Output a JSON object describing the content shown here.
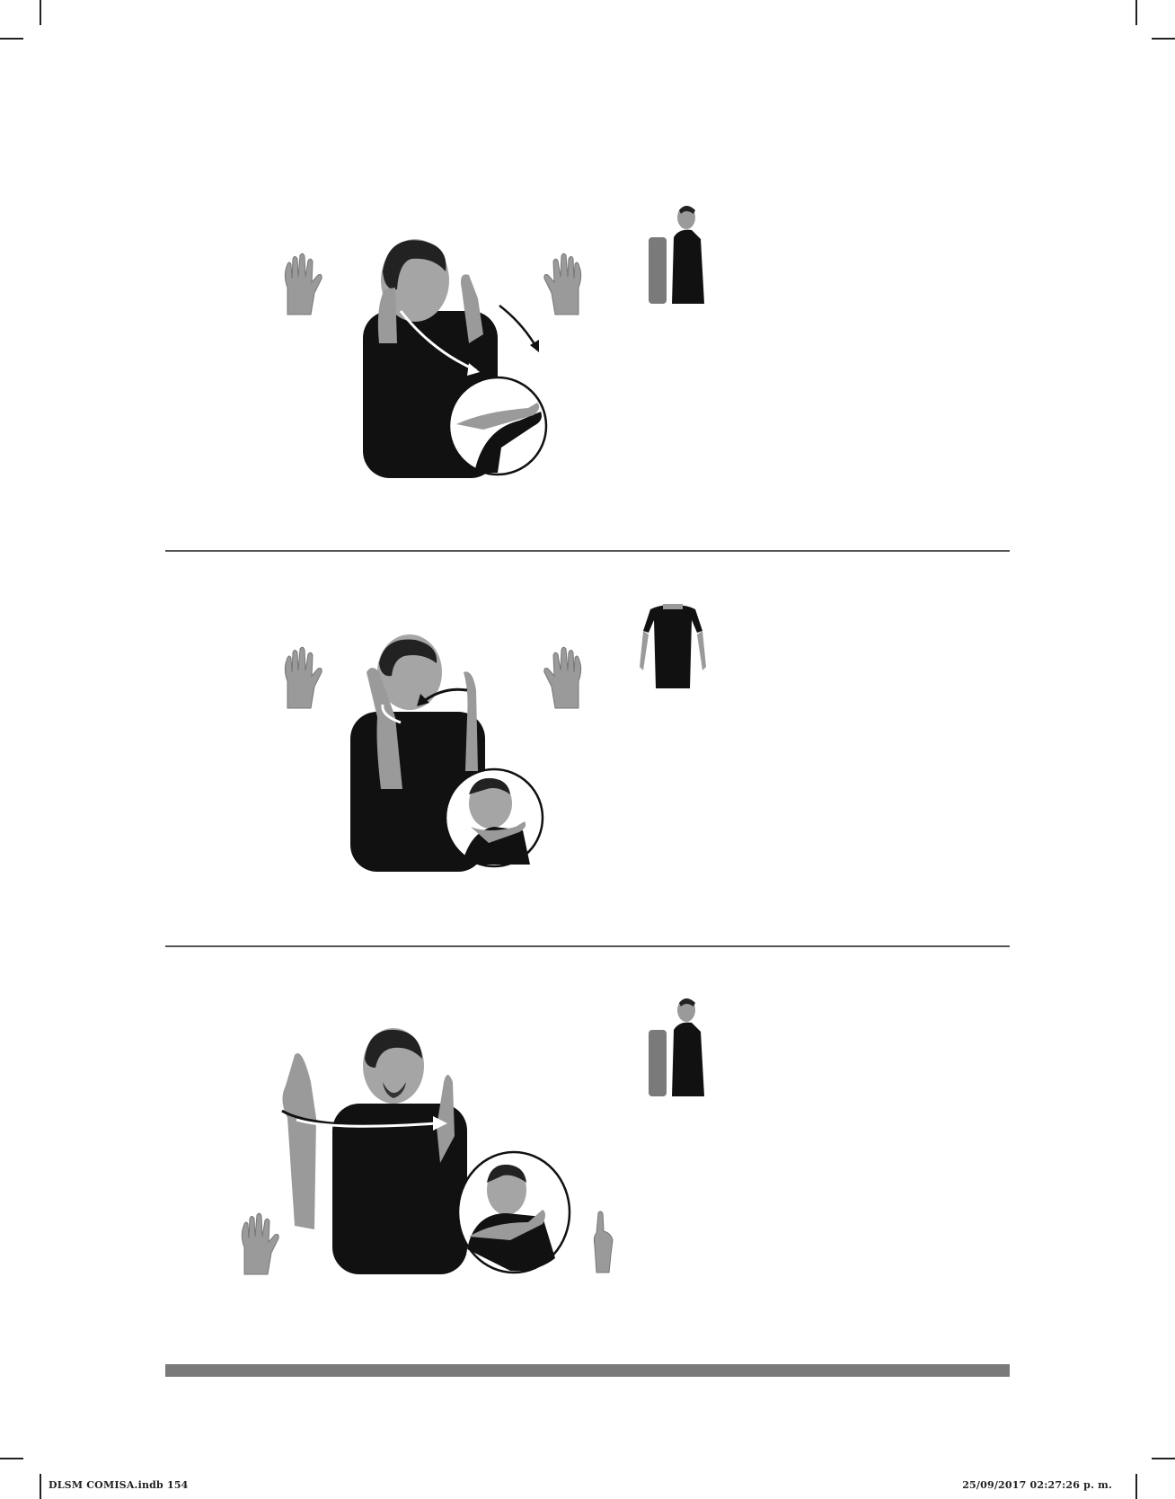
{
  "page_slug": {
    "file_label": "DLSM COMISA.indb   154",
    "timestamp": "25/09/2017   02:27:26 p. m."
  },
  "entries": [
    {
      "hand_shapes": [
        "open-hand-icon",
        "open-hand-icon"
      ],
      "position_pose": "side-view-with-pillar"
    },
    {
      "hand_shapes": [
        "open-hand-icon",
        "open-hand-icon"
      ],
      "position_pose": "front-view-arms-down"
    },
    {
      "hand_shapes": [
        "open-hand-icon",
        "index-finger-hand-icon"
      ],
      "position_pose": "side-view-with-pillar"
    }
  ],
  "colors": {
    "divider": "#555555",
    "bottom_bar": "#7a7a7a",
    "pillar": "#7a7a7a",
    "shirt": "#111111",
    "skin": "#9a9a9a"
  }
}
